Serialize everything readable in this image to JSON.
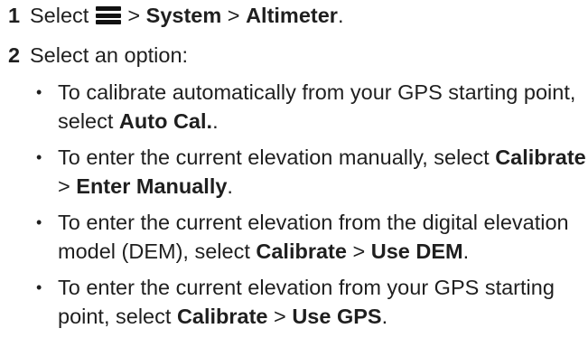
{
  "steps": [
    {
      "number": "1",
      "prefix": "Select",
      "menu_icon": "hamburger-menu-icon",
      "sep1": ">",
      "item1": "System",
      "sep2": ">",
      "item2": "Altimeter",
      "suffix": "."
    },
    {
      "number": "2",
      "text": "Select an option:"
    }
  ],
  "options": [
    {
      "bullet": "•",
      "text": "To calibrate automatically from your GPS starting point, select ",
      "bold1": "Auto Cal.",
      "end": "."
    },
    {
      "bullet": "•",
      "text": "To enter the current elevation manually, select ",
      "bold1": "Calibrate",
      "sep": " > ",
      "bold2": "Enter Manually",
      "end": "."
    },
    {
      "bullet": "•",
      "text": "To enter the current elevation from the digital elevation model (DEM), select ",
      "bold1": "Calibrate",
      "sep": " > ",
      "bold2": "Use DEM",
      "end": "."
    },
    {
      "bullet": "•",
      "text": "To enter the current elevation from your GPS starting point, select ",
      "bold1": "Calibrate",
      "sep": " > ",
      "bold2": "Use GPS",
      "end": "."
    }
  ]
}
